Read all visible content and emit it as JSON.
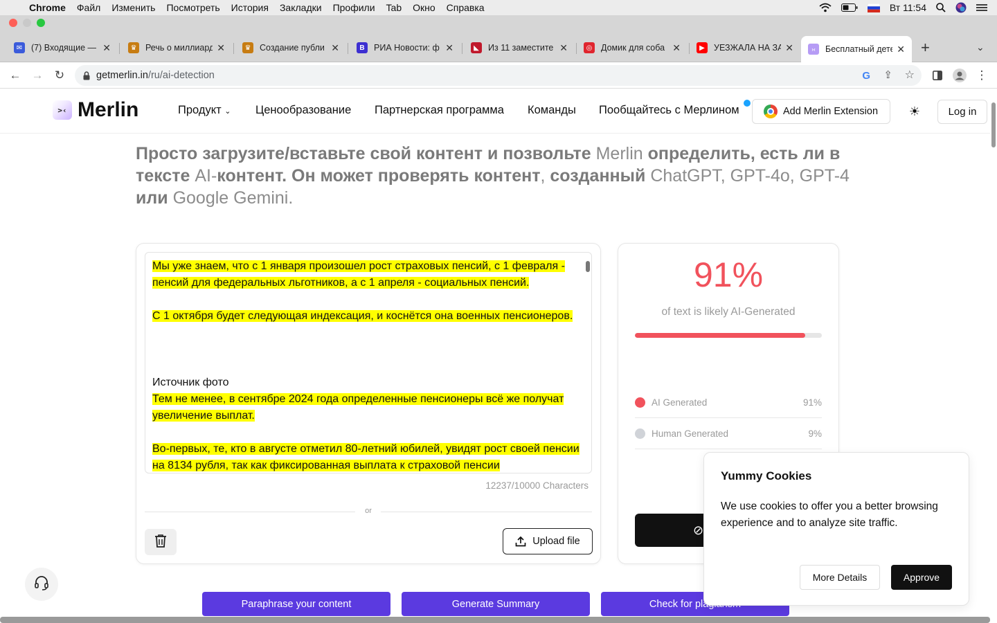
{
  "menubar": {
    "app_name": "Chrome",
    "items": [
      "Файл",
      "Изменить",
      "Посмотреть",
      "История",
      "Закладки",
      "Профили",
      "Tab",
      "Окно",
      "Справка"
    ],
    "clock": "Вт 11:54"
  },
  "tabs": [
    {
      "label": "(7) Входящие — ",
      "favicon": "mail-icon",
      "color": "#3b5bdb",
      "glyph": "✉"
    },
    {
      "label": "Речь о миллиард",
      "favicon": "shield-icon",
      "color": "#c77c12",
      "glyph": "♛"
    },
    {
      "label": "Создание публи",
      "favicon": "shield-icon",
      "color": "#c77c12",
      "glyph": "♛"
    },
    {
      "label": "РИА Новости: ф",
      "favicon": "b-icon",
      "color": "#3d2fd1",
      "glyph": "B"
    },
    {
      "label": "Из 11 заместите",
      "favicon": "flag-icon",
      "color": "#c0182b",
      "glyph": "◣"
    },
    {
      "label": "Домик для соба",
      "favicon": "circle-icon",
      "color": "#e0252e",
      "glyph": "◎"
    },
    {
      "label": "УЕЗЖАЛА НА ЗА",
      "favicon": "youtube-icon",
      "color": "#ff0000",
      "glyph": "▶"
    },
    {
      "label": "Бесплатный дете",
      "favicon": "merlin-icon",
      "color": "#b69cf5",
      "glyph": "›‹",
      "active": true
    }
  ],
  "address": {
    "host": "getmerlin.in",
    "path": "/ru/ai-detection"
  },
  "nav": {
    "logo": "Merlin",
    "logo_mark": ">‹",
    "links": [
      "Продукт",
      "Ценообразование",
      "Партнерская программа",
      "Команды",
      "Пообщайтесь с Мерлином"
    ],
    "extension_button": "Add Merlin Extension",
    "login": "Log in"
  },
  "subhead": [
    {
      "t": "Просто загрузите/вставьте свой контент и позвольте ",
      "light": false
    },
    {
      "t": "Merlin",
      "light": true
    },
    {
      "t": " определить, есть ли в тексте ",
      "light": false
    },
    {
      "t": "AI-",
      "light": true
    },
    {
      "t": "контент. Он может проверять контент",
      "light": false
    },
    {
      "t": ", ",
      "light": true
    },
    {
      "t": "созданный ",
      "light": false
    },
    {
      "t": "ChatGPT, GPT-4o, GPT-4 ",
      "light": true
    },
    {
      "t": "или ",
      "light": false
    },
    {
      "t": "Google Gemini.",
      "light": true
    }
  ],
  "editor": {
    "paragraphs": [
      {
        "text": "Мы уже знаем, что с 1 января произошел рост страховых пенсий, с 1 февраля - пенсий для федеральных льготников, а с 1 апреля - социальных пенсий.",
        "highlight": true
      },
      {
        "text": "С 1 октября будет следующая индексация, и коснётся она военных пенсионеров.",
        "highlight": true
      },
      {
        "text": "",
        "highlight": false
      },
      {
        "text": "Источник фото",
        "highlight": false,
        "tight": true
      },
      {
        "text": "Тем не менее, в сентябре 2024 года определенные пенсионеры всё же получат увеличение выплат.",
        "highlight": true
      },
      {
        "text": "Во-первых, те, кто в августе отметил 80-летний юбилей, увидят рост своей пенсии на 8134 рубля, так как фиксированная выплата к страховой пенсии",
        "highlight": true
      }
    ],
    "char_count": "12237/10000 Characters",
    "or_label": "or",
    "upload_label": "Upload file"
  },
  "result": {
    "percent_label": "91%",
    "ai_fraction": 0.91,
    "caption": "of text is likely AI-Generated",
    "legend": [
      {
        "label": "AI Generated",
        "value": "91%",
        "color": "#f1525c"
      },
      {
        "label": "Human Generated",
        "value": "9%",
        "color": "#d0d3d8"
      }
    ]
  },
  "actions": [
    "Paraphrase your content",
    "Generate Summary",
    "Check for plagiarism"
  ],
  "cookie": {
    "title": "Yummy Cookies",
    "text": "We use cookies to offer you a better browsing experience and to analyze site traffic.",
    "more": "More Details",
    "approve": "Approve"
  }
}
